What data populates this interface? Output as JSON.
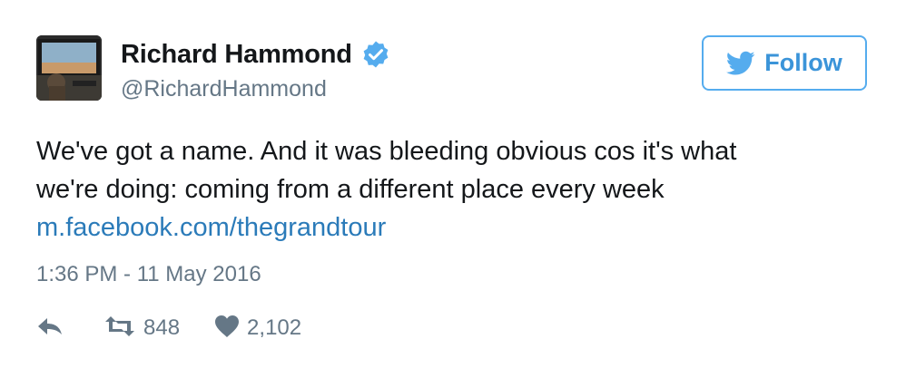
{
  "author": {
    "display_name": "Richard Hammond",
    "handle": "@RichardHammond",
    "verified": true
  },
  "follow_button": {
    "label": "Follow"
  },
  "tweet": {
    "text_line_1": "We've got a name. And it was bleeding obvious cos it's what",
    "text_line_2": "we're doing: coming from a different place every week",
    "link": "m.facebook.com/thegrandtour",
    "timestamp": "1:36 PM - 11 May 2016"
  },
  "actions": {
    "retweet_count": "848",
    "like_count": "2,102"
  },
  "colors": {
    "twitter_blue": "#55acee",
    "link_blue": "#2b7bb9",
    "muted_gray": "#657786",
    "text_dark": "#14171a"
  },
  "icons": {
    "verified": "verified-badge-icon",
    "bird": "twitter-bird-icon",
    "reply": "reply-arrow-icon",
    "retweet": "retweet-icon",
    "like": "heart-icon"
  }
}
